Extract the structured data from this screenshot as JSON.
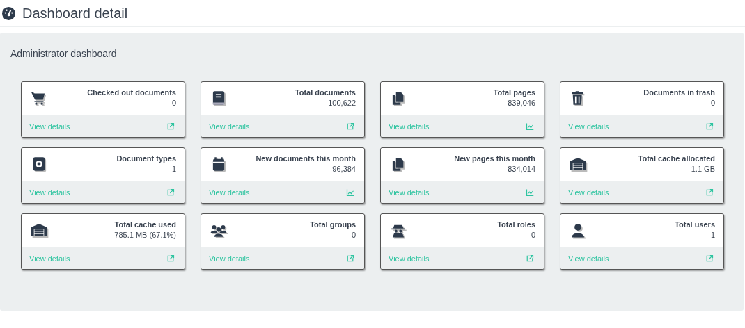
{
  "page": {
    "title": "Dashboard detail"
  },
  "panel": {
    "title": "Administrator dashboard"
  },
  "widgets": [
    {
      "label": "Checked out documents",
      "value": "0",
      "link": "View details"
    },
    {
      "label": "Total documents",
      "value": "100,622",
      "link": "View details"
    },
    {
      "label": "Total pages",
      "value": "839,046",
      "link": "View details"
    },
    {
      "label": "Documents in trash",
      "value": "0",
      "link": "View details"
    },
    {
      "label": "Document types",
      "value": "1",
      "link": "View details"
    },
    {
      "label": "New documents this month",
      "value": "96,384",
      "link": "View details"
    },
    {
      "label": "New pages this month",
      "value": "834,014",
      "link": "View details"
    },
    {
      "label": "Total cache allocated",
      "value": "1.1 GB",
      "link": "View details"
    },
    {
      "label": "Total cache used",
      "value": "785.1 MB (67.1%)",
      "link": "View details"
    },
    {
      "label": "Total groups",
      "value": "0",
      "link": "View details"
    },
    {
      "label": "Total roles",
      "value": "0",
      "link": "View details"
    },
    {
      "label": "Total users",
      "value": "1",
      "link": "View details"
    }
  ]
}
